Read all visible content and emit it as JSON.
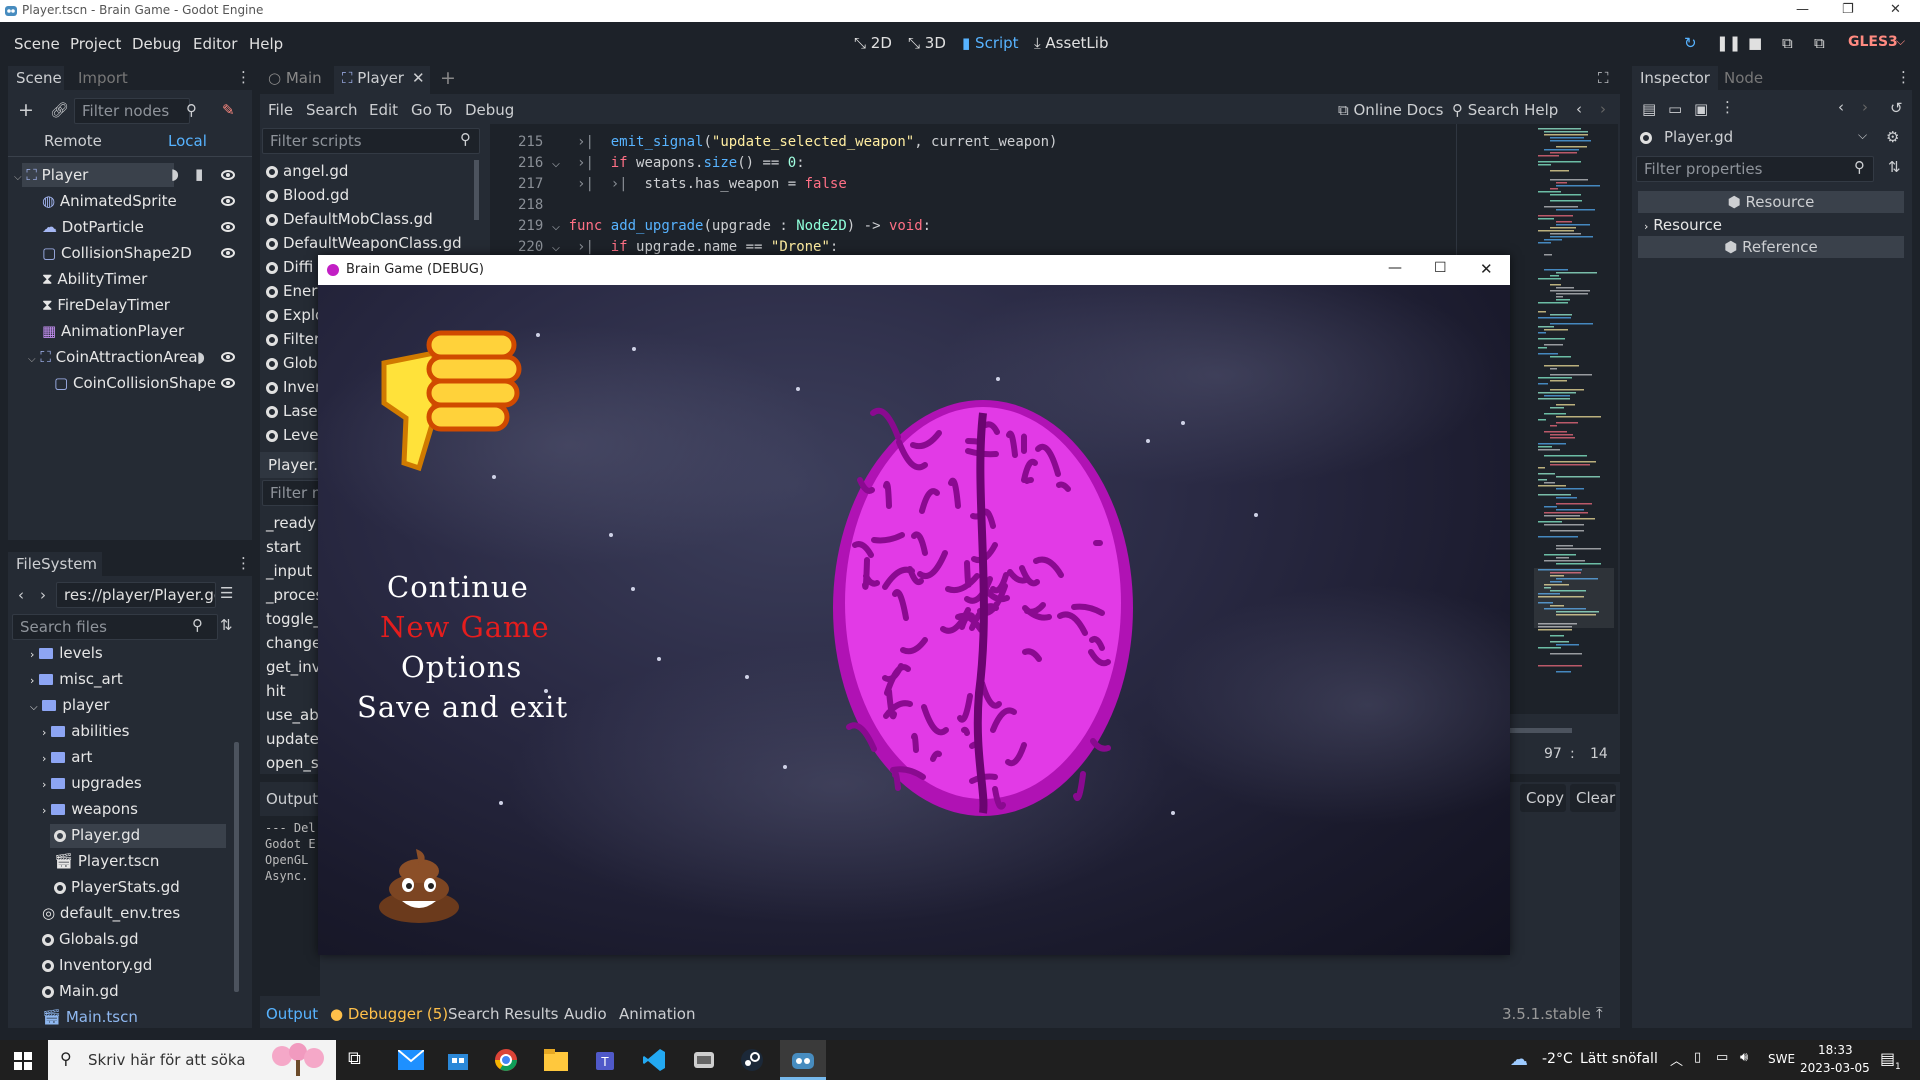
{
  "window": {
    "title": "Player.tscn - Brain Game - Godot Engine"
  },
  "menu": {
    "items": [
      "Scene",
      "Project",
      "Debug",
      "Editor",
      "Help"
    ]
  },
  "workspaces": {
    "d2": "2D",
    "d3": "3D",
    "script": "Script",
    "assetlib": "AssetLib"
  },
  "renderer": "GLES3",
  "scene_dock": {
    "tabs": [
      "Scene",
      "Import"
    ],
    "filter_placeholder": "Filter nodes",
    "remote": "Remote",
    "local": "Local",
    "nodes": [
      "Player",
      "AnimatedSprite",
      "DotParticle",
      "CollisionShape2D",
      "AbilityTimer",
      "FireDelayTimer",
      "AnimationPlayer",
      "CoinAttractionArea",
      "CoinCollisionShape"
    ]
  },
  "filesystem": {
    "title": "FileSystem",
    "path": "res://player/Player.gd",
    "search_placeholder": "Search files",
    "items": [
      "levels",
      "misc_art",
      "player",
      "abilities",
      "art",
      "upgrades",
      "weapons",
      "Player.gd",
      "Player.tscn",
      "PlayerStats.gd",
      "default_env.tres",
      "Globals.gd",
      "Inventory.gd",
      "Main.gd",
      "Main.tscn"
    ]
  },
  "editor_tabs": [
    "Main",
    "Player"
  ],
  "script_menu": {
    "file": "File",
    "search": "Search",
    "edit": "Edit",
    "goto": "Go To",
    "debug": "Debug",
    "docs": "Online Docs",
    "help": "Search Help"
  },
  "scripts_panel": {
    "filter_placeholder": "Filter scripts",
    "scripts": [
      "angel.gd",
      "Blood.gd",
      "DefaultMobClass.gd",
      "DefaultWeaponClass.gd",
      "Diffi",
      "Ener",
      "Explo",
      "Filter",
      "Glob",
      "Inver",
      "Lase",
      "Leve"
    ],
    "current": "Player.g",
    "methods_filter": "Filter m",
    "methods": [
      "_ready",
      "start",
      "_input",
      "_proces",
      "toggle_",
      "change",
      "get_inv",
      "hit",
      "use_abi",
      "update_",
      "open_sh"
    ]
  },
  "code": {
    "line_numbers": [
      "215",
      "216",
      "217",
      "218",
      "219",
      "220"
    ],
    "cursor": {
      "line": "97",
      "sep": ":",
      "col": "14"
    }
  },
  "output": {
    "label": "Output:",
    "lines": [
      "--- Del",
      "Godot E",
      "OpenGL",
      "Async."
    ],
    "copy": "Copy",
    "clear": "Clear"
  },
  "bottom_tabs": {
    "output": "Output",
    "debugger": "Debugger (5)",
    "search": "Search Results",
    "audio": "Audio",
    "animation": "Animation",
    "version": "3.5.1.stable"
  },
  "inspector": {
    "tabs": [
      "Inspector",
      "Node"
    ],
    "object": "Player.gd",
    "filter_placeholder": "Filter properties",
    "resource_header": "Resource",
    "resource_item": "Resource",
    "reference_header": "Reference"
  },
  "game": {
    "title": "Brain Game (DEBUG)",
    "menu": [
      "Continue",
      "New Game",
      "Options",
      "Save and exit"
    ],
    "selected_index": 1
  },
  "taskbar": {
    "search_placeholder": "Skriv här för att söka",
    "weather_temp": "-2°C",
    "weather_text": "Lätt snöfall",
    "lang": "SWE",
    "time": "18:33",
    "date": "2023-03-05",
    "notif_count": "1"
  },
  "colors": {
    "accent": "#57b3ff",
    "selected_menu": "#e51d1d",
    "brain": "#d21fd4"
  }
}
